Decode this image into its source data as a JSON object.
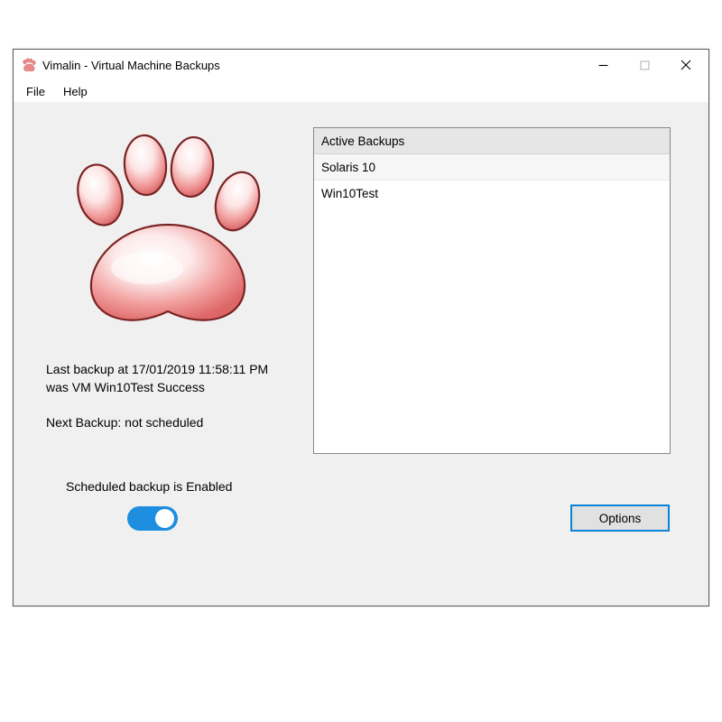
{
  "window": {
    "title": "Vimalin - Virtual Machine Backups"
  },
  "menubar": {
    "file": "File",
    "help": "Help"
  },
  "status": {
    "last_line1": "Last backup at 17/01/2019 11:58:11 PM",
    "last_line2": "was VM Win10Test Success",
    "next": "Next Backup: not scheduled"
  },
  "schedule": {
    "label": "Scheduled backup is Enabled",
    "enabled": true
  },
  "backups": {
    "header": "Active Backups",
    "items": [
      "Solaris 10",
      "Win10Test"
    ]
  },
  "buttons": {
    "options": "Options"
  }
}
